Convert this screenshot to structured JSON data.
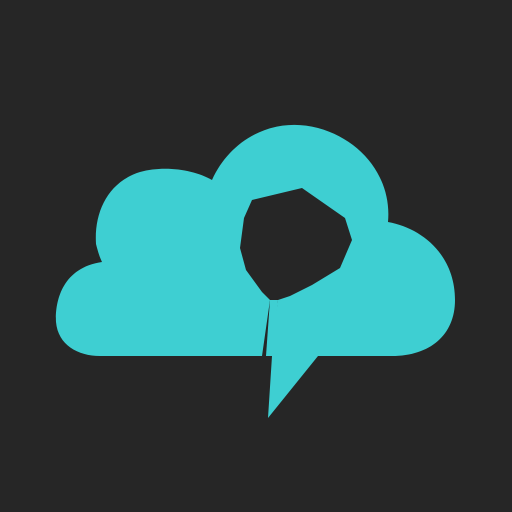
{
  "app_icon": {
    "icon_name": "cloud-speech-bubble-pin-icon",
    "colors": {
      "background": "#262626",
      "accent": "#3ecfd2"
    }
  }
}
